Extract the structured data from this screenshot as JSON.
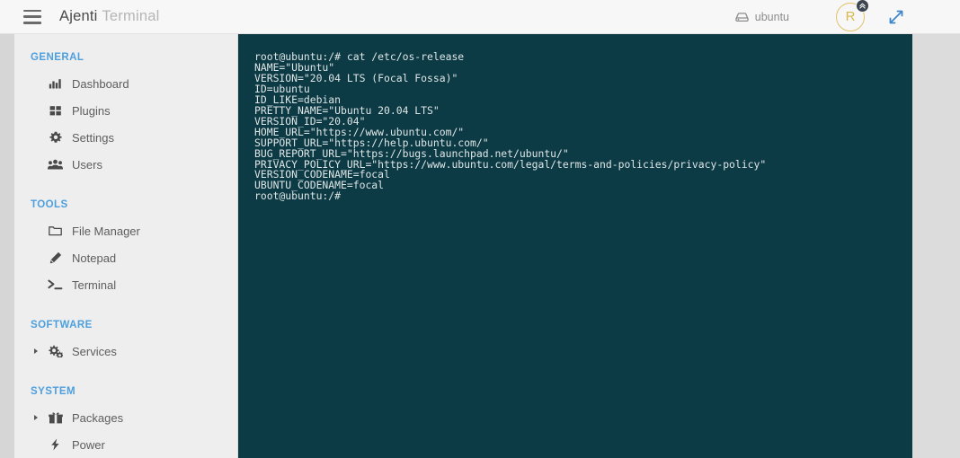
{
  "header": {
    "menu_icon": "hamburger-menu-icon",
    "brand_primary": "Ajenti",
    "brand_secondary": "Terminal",
    "server_icon": "server-icon",
    "server_label": "ubuntu",
    "avatar_initial": "R",
    "avatar_badge_icon": "double-chevron-up-icon",
    "expand_icon": "expand-arrows-icon",
    "accent_blue": "#4d9fdd",
    "avatar_gold": "#d8b84e"
  },
  "sidebar": {
    "sections": [
      {
        "title": "GENERAL",
        "items": [
          {
            "label": "Dashboard",
            "icon": "chart-bar-icon",
            "expandable": false
          },
          {
            "label": "Plugins",
            "icon": "grid-blocks-icon",
            "expandable": false
          },
          {
            "label": "Settings",
            "icon": "gear-icon",
            "expandable": false
          },
          {
            "label": "Users",
            "icon": "users-icon",
            "expandable": false
          }
        ]
      },
      {
        "title": "TOOLS",
        "items": [
          {
            "label": "File Manager",
            "icon": "folder-icon",
            "expandable": false
          },
          {
            "label": "Notepad",
            "icon": "pencil-icon",
            "expandable": false
          },
          {
            "label": "Terminal",
            "icon": "prompt-icon",
            "expandable": false
          }
        ]
      },
      {
        "title": "SOFTWARE",
        "items": [
          {
            "label": "Services",
            "icon": "gears-icon",
            "expandable": true
          }
        ]
      },
      {
        "title": "SYSTEM",
        "items": [
          {
            "label": "Packages",
            "icon": "package-gift-icon",
            "expandable": true
          },
          {
            "label": "Power",
            "icon": "bolt-icon",
            "expandable": false
          }
        ]
      }
    ]
  },
  "terminal": {
    "background": "#0c3a45",
    "foreground": "#dfe6e6",
    "lines": [
      "root@ubuntu:/# cat /etc/os-release",
      "NAME=\"Ubuntu\"",
      "VERSION=\"20.04 LTS (Focal Fossa)\"",
      "ID=ubuntu",
      "ID_LIKE=debian",
      "PRETTY_NAME=\"Ubuntu 20.04 LTS\"",
      "VERSION_ID=\"20.04\"",
      "HOME_URL=\"https://www.ubuntu.com/\"",
      "SUPPORT_URL=\"https://help.ubuntu.com/\"",
      "BUG_REPORT_URL=\"https://bugs.launchpad.net/ubuntu/\"",
      "PRIVACY_POLICY_URL=\"https://www.ubuntu.com/legal/terms-and-policies/privacy-policy\"",
      "VERSION_CODENAME=focal",
      "UBUNTU_CODENAME=focal",
      "root@ubuntu:/#"
    ]
  }
}
